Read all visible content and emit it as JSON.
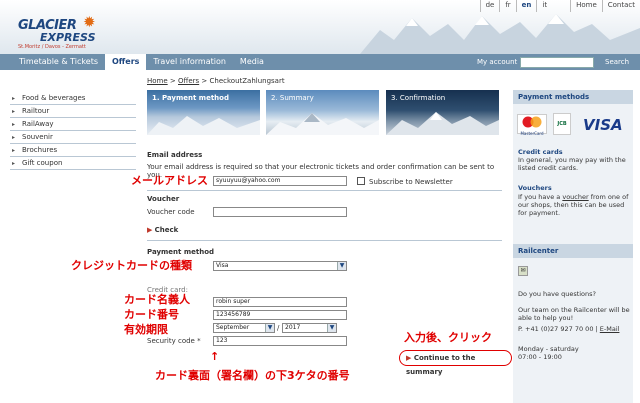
{
  "header": {
    "logo_line1": "GLACIER",
    "logo_line2": "EXPRESS",
    "logo_sub": "St.Moritz / Davos - Zermatt",
    "languages": [
      "de",
      "fr",
      "en",
      "it"
    ],
    "links": [
      "Home",
      "Contact"
    ]
  },
  "nav": {
    "items": [
      "Timetable & Tickets",
      "Offers",
      "Travel information",
      "Media"
    ],
    "active": "Offers",
    "account_label": "My account",
    "search_label": "Search"
  },
  "sidebar": {
    "items": [
      "Food & beverages",
      "Railtour",
      "RailAway",
      "Souvenir",
      "Brochures",
      "Gift coupon"
    ]
  },
  "breadcrumb": {
    "home": "Home",
    "sep1": " > ",
    "offers": "Offers",
    "sep2": " > ",
    "current": "CheckoutZahlungsart"
  },
  "steps": [
    "1. Payment method",
    "2. Summary",
    "3. Confirmation"
  ],
  "form": {
    "email_heading": "Email address",
    "email_desc": "Your email address is required so that your electronic tickets and order confirmation can be sent to you.",
    "email_value": "syuuyuu@yahoo.com",
    "newsletter_label": "Subscribe to Newsletter",
    "voucher_heading": "Voucher",
    "voucher_code_label": "Voucher code",
    "check_label": "Check",
    "payment_method_heading": "Payment method",
    "payment_method_value": "Visa",
    "credit_card_label": "Credit card:",
    "cardholder_value": "robin super",
    "card_number_value": "123456789",
    "expiry_month": "September",
    "expiry_separator": "/",
    "expiry_year": "2017",
    "security_code_label": "Security code *",
    "security_code_value": "123",
    "continue_label": "Continue to the summary"
  },
  "annotations": {
    "email": "メールアドレス",
    "card_type": "クレジットカードの種類",
    "cardholder": "カード名義人",
    "card_number": "カード番号",
    "expiry": "有効期限",
    "after_input": "入力後、クリック",
    "up_arrow": "↑",
    "security": "カード裏面（署名欄）の下3ケタの番号"
  },
  "right": {
    "payment_methods_heading": "Payment methods",
    "card_brands": [
      "MasterCard",
      "JCB",
      "VISA"
    ],
    "credit_cards_title": "Credit cards",
    "credit_cards_text": "In general, you may pay with the listed credit cards.",
    "vouchers_title": "Vouchers",
    "vouchers_text_1": "If you have a ",
    "vouchers_link": "voucher",
    "vouchers_text_2": " from one of our shops, then this can be used for payment.",
    "railcenter_heading": "Railcenter",
    "question": "Do you have questions?",
    "help_text": "Our team on the Railcenter will be able to help you!",
    "phone": "P. +41 (0)27 927 70 00 | ",
    "email_link": "E-Mail",
    "hours_label": "Monday - saturday",
    "hours": "07:00 - 19:00"
  },
  "colors": {
    "nav_bg": "#6e8fab",
    "brand_blue": "#1e4780",
    "annotation_red": "#e00000"
  }
}
